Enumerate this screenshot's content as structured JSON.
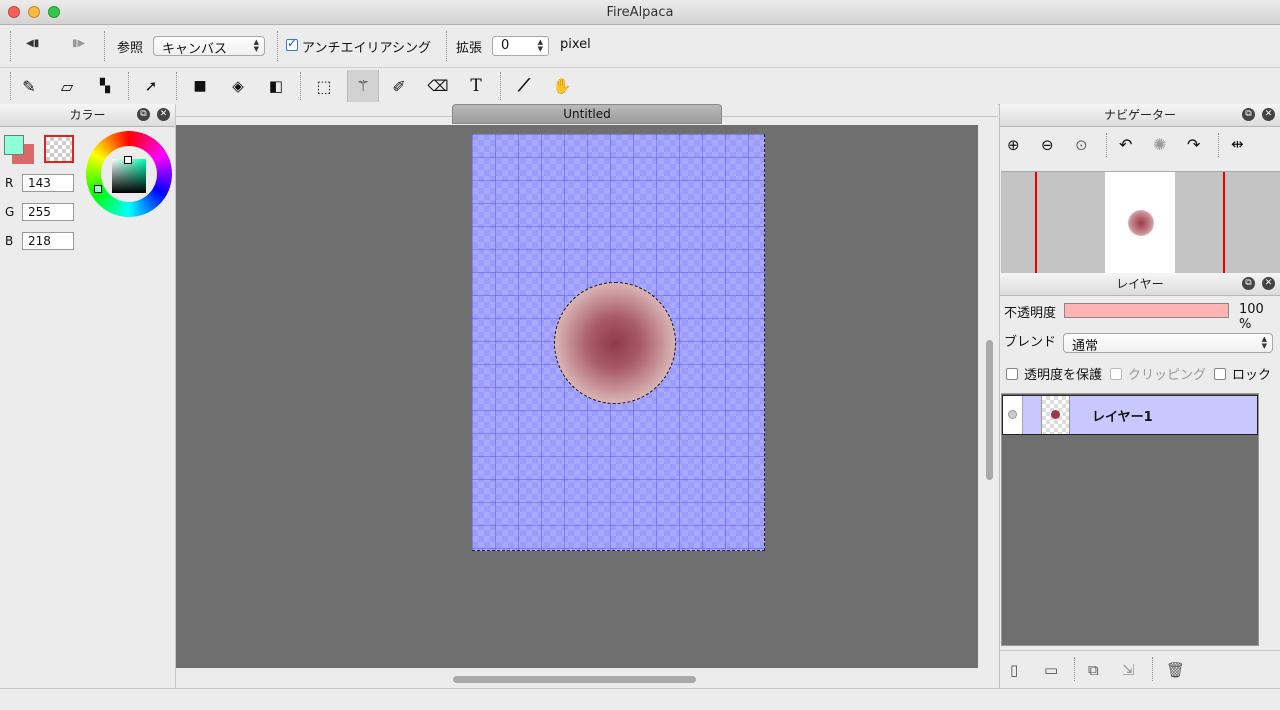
{
  "window": {
    "title": "FireAlpaca",
    "lights": {
      "close": "#fc605b",
      "minimize": "#fdbc40",
      "zoom": "#34c84a"
    }
  },
  "options": {
    "prev_label": "◀▮",
    "next_label": "▮▶",
    "reference_label": "参照",
    "reference_value": "キャンバス",
    "antialias_label": "アンチエイリアシング",
    "antialias_checked": true,
    "expand_label": "拡張",
    "expand_value": "0",
    "expand_unit": "pixel"
  },
  "tools": [
    {
      "name": "pen-tool",
      "icon": "pen-icon",
      "glyph": "✎"
    },
    {
      "name": "eraser-tool",
      "icon": "eraser-icon",
      "glyph": "▱"
    },
    {
      "name": "dot-tool",
      "icon": "dot-icon",
      "glyph": "▚"
    },
    {
      "name": "move-tool",
      "icon": "move-icon",
      "glyph": "➚"
    },
    {
      "name": "fill-rect-tool",
      "icon": "fill-rect-icon",
      "glyph": "■"
    },
    {
      "name": "bucket-tool",
      "icon": "bucket-icon",
      "glyph": "◈"
    },
    {
      "name": "gradient-tool",
      "icon": "gradient-icon",
      "glyph": "◧"
    },
    {
      "name": "select-tool",
      "icon": "select-icon",
      "glyph": "⬚"
    },
    {
      "name": "magic-wand-tool",
      "icon": "magic-wand-icon",
      "glyph": "⚚"
    },
    {
      "name": "select-pen-tool",
      "icon": "select-pen-icon",
      "glyph": "✐"
    },
    {
      "name": "select-eraser-tool",
      "icon": "select-eraser-icon",
      "glyph": "⌫"
    },
    {
      "name": "text-tool",
      "icon": "text-icon",
      "glyph": "T"
    },
    {
      "name": "eyedropper-tool",
      "icon": "eyedropper-icon",
      "glyph": "⟋"
    },
    {
      "name": "hand-tool",
      "icon": "hand-icon",
      "glyph": "✋"
    }
  ],
  "color_panel": {
    "title": "カラー",
    "foreground": "#8fffda",
    "background": "#d86a6a",
    "r_label": "R",
    "r": "143",
    "g_label": "G",
    "g": "255",
    "b_label": "B",
    "b": "218"
  },
  "document": {
    "tab_title": "Untitled",
    "canvas_color": "#9c9cff",
    "viewport_color": "#6f6f6f"
  },
  "navigator": {
    "title": "ナビゲーター",
    "buttons": [
      "zoom-in-icon",
      "zoom-out-icon",
      "zoom-fit-icon",
      "rotate-left-icon",
      "rotate-reset-icon",
      "rotate-right-icon",
      "flip-icon"
    ]
  },
  "layers": {
    "title": "レイヤー",
    "opacity_label": "不透明度",
    "opacity_value": "100 %",
    "opacity_fraction": 1.0,
    "blend_label": "ブレンド",
    "blend_value": "通常",
    "protect_alpha_label": "透明度を保護",
    "clipping_label": "クリッピング",
    "lock_label": "ロック",
    "items": [
      {
        "name": "レイヤー1",
        "selected": true
      }
    ]
  }
}
